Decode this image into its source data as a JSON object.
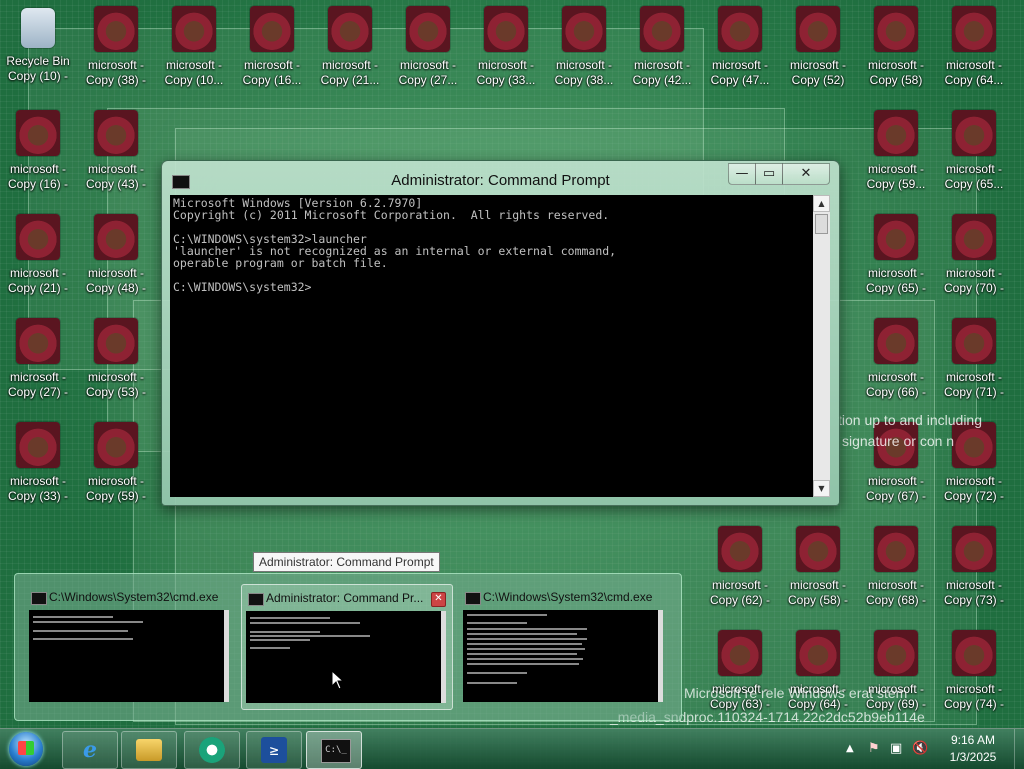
{
  "desktop": {
    "icons": [
      {
        "label1": "Recycle Bin",
        "label2": "Copy (10) -"
      },
      {
        "label1": "microsoft -",
        "label2": "Copy (38) -"
      },
      {
        "label1": "microsoft -",
        "label2": "Copy (10..."
      },
      {
        "label1": "microsoft -",
        "label2": "Copy (16..."
      },
      {
        "label1": "microsoft -",
        "label2": "Copy (21..."
      },
      {
        "label1": "microsoft -",
        "label2": "Copy (27..."
      },
      {
        "label1": "microsoft -",
        "label2": "Copy (33..."
      },
      {
        "label1": "microsoft -",
        "label2": "Copy (38..."
      },
      {
        "label1": "microsoft -",
        "label2": "Copy (42..."
      },
      {
        "label1": "microsoft -",
        "label2": "Copy (47..."
      },
      {
        "label1": "microsoft -",
        "label2": "Copy (52)"
      },
      {
        "label1": "microsoft -",
        "label2": "Copy (58)"
      },
      {
        "label1": "microsoft -",
        "label2": "Copy (64..."
      },
      {
        "label1": "microsoft -",
        "label2": "Copy (16) -"
      },
      {
        "label1": "microsoft -",
        "label2": "Copy (43) -"
      },
      {
        "label1": "microsoft -",
        "label2": "Copy (59..."
      },
      {
        "label1": "microsoft -",
        "label2": "Copy (65..."
      },
      {
        "label1": "microsoft -",
        "label2": "Copy (21) -"
      },
      {
        "label1": "microsoft -",
        "label2": "Copy (48) -"
      },
      {
        "label1": "microsoft -",
        "label2": "Copy (65) -"
      },
      {
        "label1": "microsoft -",
        "label2": "Copy (70) -"
      },
      {
        "label1": "microsoft -",
        "label2": "Copy (27) -"
      },
      {
        "label1": "microsoft -",
        "label2": "Copy (53) -"
      },
      {
        "label1": "microsoft -",
        "label2": "Copy (66) -"
      },
      {
        "label1": "microsoft -",
        "label2": "Copy (71) -"
      },
      {
        "label1": "microsoft -",
        "label2": "Copy (33) -"
      },
      {
        "label1": "microsoft -",
        "label2": "Copy (59) -"
      },
      {
        "label1": "microsoft -",
        "label2": "Copy (67) -"
      },
      {
        "label1": "microsoft -",
        "label2": "Copy (72) -"
      },
      {
        "label1": "microsoft -",
        "label2": "Copy (62) -"
      },
      {
        "label1": "microsoft -",
        "label2": "Copy (58) -"
      },
      {
        "label1": "microsoft -",
        "label2": "Copy (68) -"
      },
      {
        "label1": "microsoft -",
        "label2": "Copy (73) -"
      },
      {
        "label1": "microsoft -",
        "label2": "Copy (63) -"
      },
      {
        "label1": "microsoft -",
        "label2": "Copy (64) -"
      },
      {
        "label1": "microsoft -",
        "label2": "Copy (69) -"
      },
      {
        "label1": "microsoft -",
        "label2": "Copy (74) -"
      }
    ],
    "bg_text_1": "tion up to and including",
    "bg_text_2": "signature or con n",
    "bg_text_3": "Microsoft re rele Windows erat stem",
    "bg_text_4": "_media_sndproc.110324-1714.22c2dc52b9eb114e"
  },
  "cmd_window": {
    "title": "Administrator: Command Prompt",
    "minimize": "—",
    "maximize": "▭",
    "close": "✕",
    "lines": [
      "Microsoft Windows [Version 6.2.7970]",
      "Copyright (c) 2011 Microsoft Corporation.  All rights reserved.",
      "",
      "C:\\WINDOWS\\system32>launcher",
      "'launcher' is not recognized as an internal or external command,",
      "operable program or batch file.",
      "",
      "C:\\WINDOWS\\system32>"
    ]
  },
  "tooltip": "Administrator: Command Prompt",
  "thumbnails": [
    {
      "title": "C:\\Windows\\System32\\cmd.exe"
    },
    {
      "title": "Administrator: Command Pr...",
      "close": "✕"
    },
    {
      "title": "C:\\Windows\\System32\\cmd.exe"
    }
  ],
  "taskbar": {
    "ie_glyph": "e",
    "ps_glyph": "≥",
    "cmd_glyph": "C:\\_",
    "time": "9:16 AM",
    "date": "1/3/2025",
    "tray_up": "▲",
    "tray_flag": "⚑",
    "tray_net": "▣",
    "tray_vol": "🔇"
  }
}
